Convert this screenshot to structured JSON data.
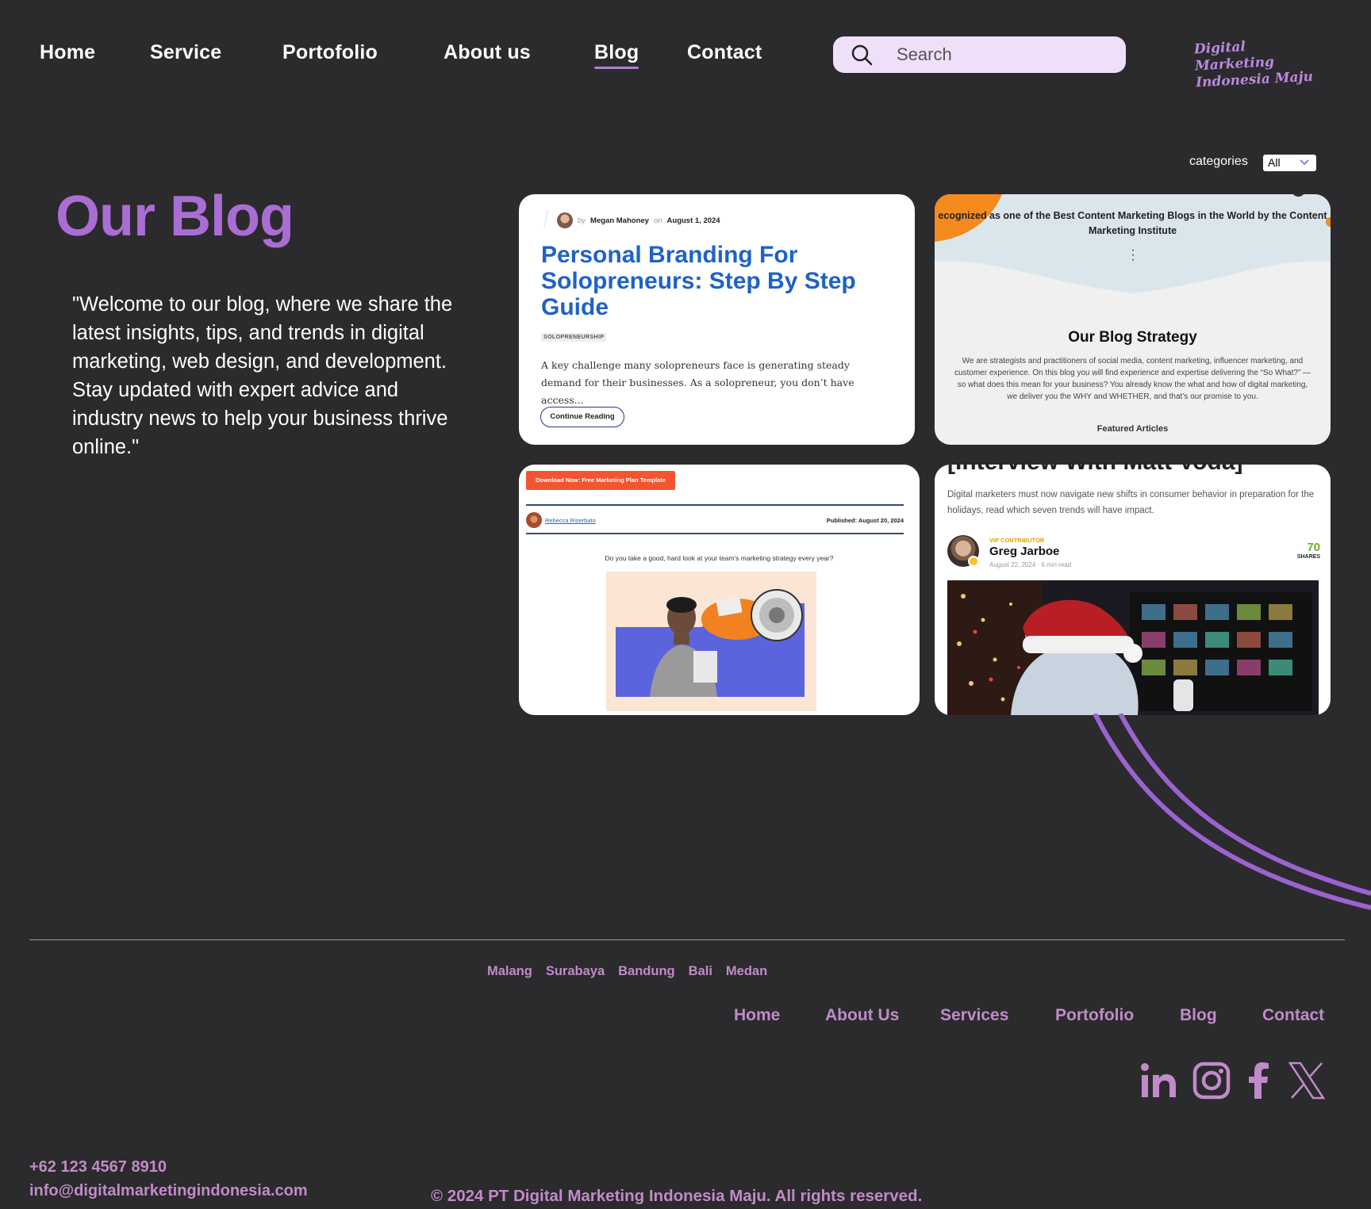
{
  "nav": {
    "items": [
      {
        "label": "Home"
      },
      {
        "label": "Service"
      },
      {
        "label": "Portofolio"
      },
      {
        "label": "About us"
      },
      {
        "label": "Blog",
        "active": true
      },
      {
        "label": "Contact"
      }
    ],
    "search_placeholder": "Search",
    "logo_line1": "Digital Marketing",
    "logo_line2": "Indonesia Maju"
  },
  "hero": {
    "title": "Our Blog",
    "text": "\"Welcome to our blog, where we share the latest insights, tips, and trends in digital marketing, web design, and development. Stay updated with expert advice and industry news to help your business thrive online.\""
  },
  "categories": {
    "label": "categories",
    "selected": "All"
  },
  "cards": {
    "c1": {
      "by": "by",
      "author": "Megan Mahoney",
      "on": "on",
      "date": "August 1, 2024",
      "title": "Personal Branding For Solopreneurs: Step By Step Guide",
      "tag": "SOLOPRENEURSHIP",
      "excerpt": "A key challenge many solopreneurs face is generating steady demand for their businesses. As a solopreneur, you don’t have access...",
      "button": "Continue Reading"
    },
    "c2": {
      "banner": "ecognized as one of the Best Content Marketing Blogs in the World by the Content Marketing Institute",
      "heading": "Our Blog Strategy",
      "body": "We are strategists and practitioners of social media, content marketing, influencer marketing, and customer experience. On this blog you will find experience and expertise delivering the “So What?” — so what does this mean for your business? You already know the what and how of digital marketing, we deliver you the WHY and WHETHER, and that’s our promise to you.",
      "footer": "Featured Articles"
    },
    "c3": {
      "button": "Download Now: Free Marketing Plan Template",
      "author": "Rebecca Riserbato",
      "date": "Published: August 20, 2024",
      "question": "Do you take a good, hard look at your team's marketing strategy every year?"
    },
    "c4": {
      "headline": "[Interview With Matt Voda]",
      "excerpt": "Digital marketers must now navigate new shifts in consumer behavior in preparation for the holidays, read which seven trends will have impact.",
      "badge": "VIP CONTRIBUTOR",
      "name": "Greg Jarboe",
      "date": "August 22, 2024 · 6 min read",
      "shares_count": "70",
      "shares_label": "SHARES"
    }
  },
  "footer": {
    "cities": [
      "Malang",
      "Surabaya",
      "Bandung",
      "Bali",
      "Medan"
    ],
    "nav": [
      "Home",
      "About Us",
      "Services",
      "Portofolio",
      "Blog",
      "Contact"
    ],
    "social": [
      "linkedin-icon",
      "instagram-icon",
      "facebook-icon",
      "x-icon"
    ],
    "phone": "+62 123 4567 8910",
    "email": "info@digitalmarketingindonesia.com",
    "copyright": "© 2024 PT Digital Marketing Indonesia Maju. All rights reserved."
  },
  "colors": {
    "background": "#2b2a2c",
    "accent": "#a96dd3",
    "footer_text": "#c08bc8",
    "search_bg": "#efdff9"
  }
}
